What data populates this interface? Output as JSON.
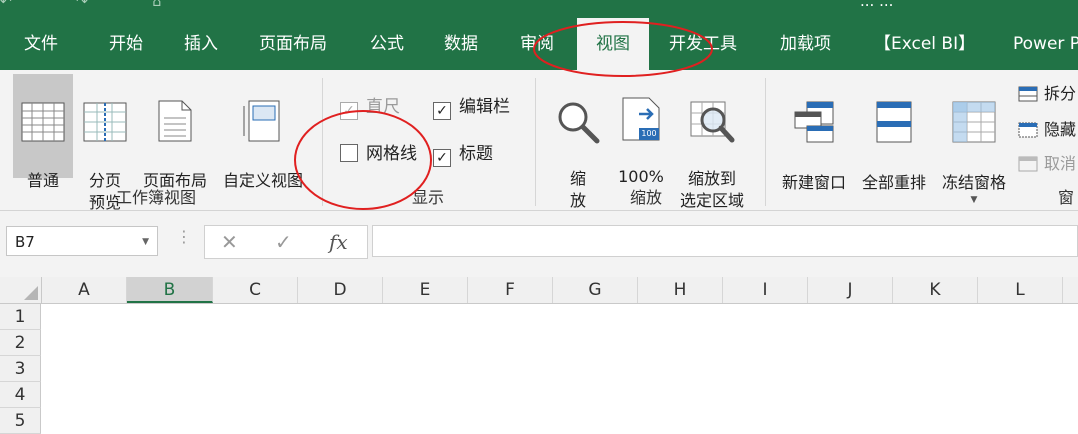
{
  "colors": {
    "brand": "#217346",
    "annotation": "#e02020"
  },
  "title_bar": {
    "title": "...   ..."
  },
  "tabs": [
    {
      "label": "文件"
    },
    {
      "label": "开始"
    },
    {
      "label": "插入"
    },
    {
      "label": "页面布局"
    },
    {
      "label": "公式"
    },
    {
      "label": "数据"
    },
    {
      "label": "审阅"
    },
    {
      "label": "视图",
      "active": true
    },
    {
      "label": "开发工具"
    },
    {
      "label": "加载项"
    },
    {
      "label": "【Excel BI】"
    },
    {
      "label": "Power P"
    }
  ],
  "ribbon": {
    "workbook_views": {
      "label": "工作簿视图",
      "normal": "普通",
      "page_break": "分页\n预览",
      "page_layout": "页面布局",
      "custom_views": "自定义视图"
    },
    "show": {
      "label": "显示",
      "ruler": {
        "label": "直尺",
        "checked": true,
        "disabled": true
      },
      "formula_bar": {
        "label": "编辑栏",
        "checked": true
      },
      "gridlines": {
        "label": "网格线",
        "checked": false
      },
      "headings": {
        "label": "标题",
        "checked": true
      }
    },
    "zoom": {
      "label": "缩放",
      "zoom": "缩\n放",
      "zoom_100": "100%",
      "zoom_100_badge": "100",
      "zoom_selection": "缩放到\n选定区域"
    },
    "window": {
      "label": "窗",
      "new_window": "新建窗口",
      "arrange_all": "全部重排",
      "freeze_panes": "冻结窗格",
      "split": "拆分",
      "hide": "隐藏",
      "unhide": "取消"
    }
  },
  "formula_bar": {
    "name_box": "B7",
    "cancel": "✕",
    "enter": "✓",
    "fx": "fx",
    "value": ""
  },
  "columns": [
    "A",
    "B",
    "C",
    "D",
    "E",
    "F",
    "G",
    "H",
    "I",
    "J",
    "K",
    "L"
  ],
  "selected_column": "B",
  "rows": [
    "1",
    "2",
    "3",
    "4",
    "5"
  ]
}
